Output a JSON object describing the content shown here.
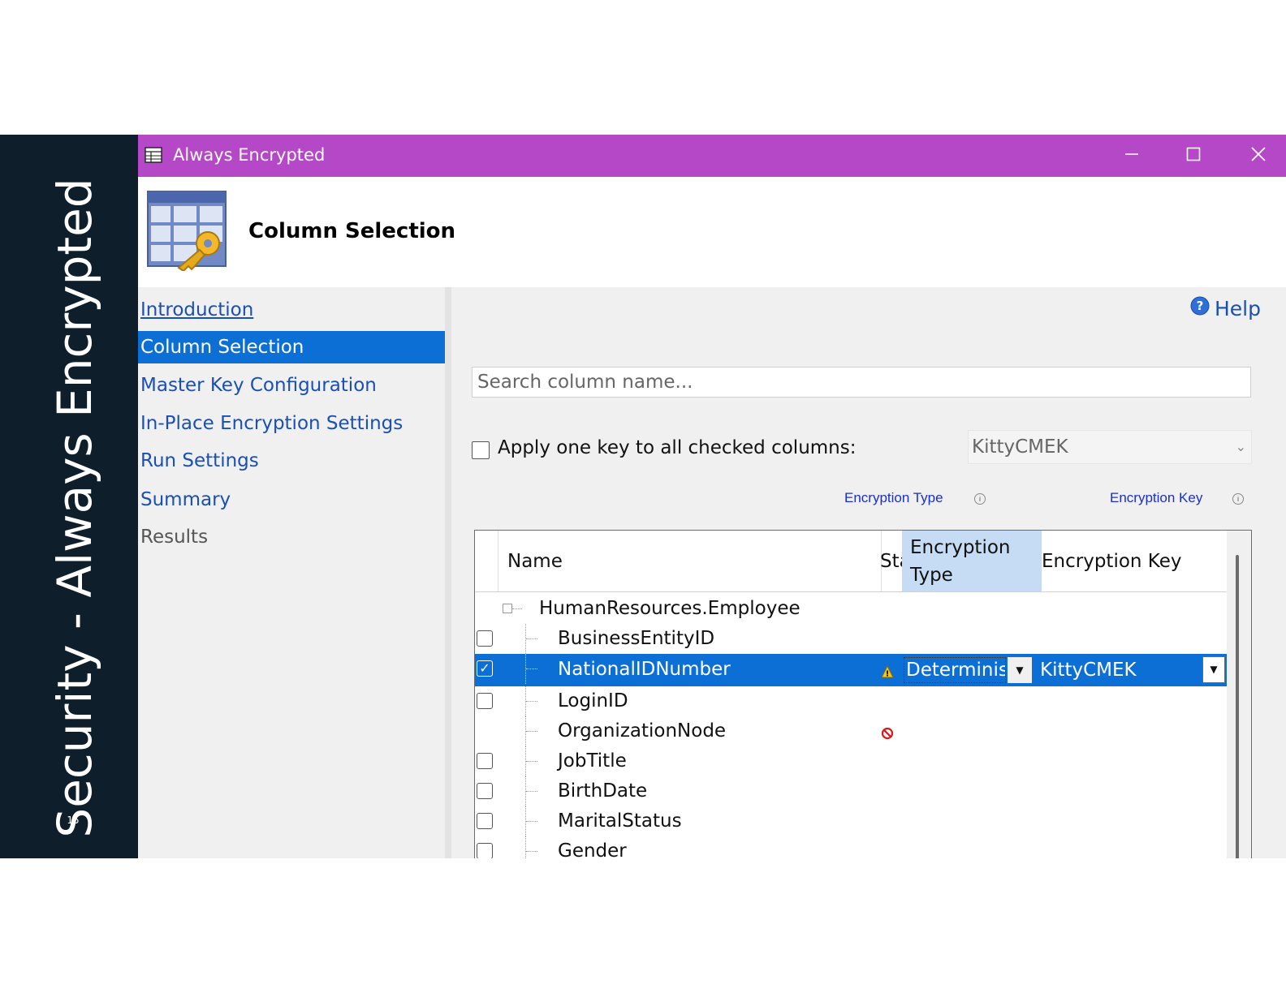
{
  "slide": {
    "title": "Security - Always Encrypted",
    "page_number": "15"
  },
  "window": {
    "title": "Always Encrypted",
    "icons": {
      "app": "wizard-table-icon",
      "minimize": "minimize-icon",
      "maximize": "maximize-icon",
      "close": "close-icon"
    }
  },
  "header": {
    "title": "Column Selection",
    "icon": "table-key-icon"
  },
  "nav": {
    "items": [
      {
        "label": "Introduction",
        "state": "link"
      },
      {
        "label": "Column Selection",
        "state": "active"
      },
      {
        "label": "Master Key Configuration",
        "state": "normal"
      },
      {
        "label": "In-Place Encryption Settings",
        "state": "normal"
      },
      {
        "label": "Run Settings",
        "state": "normal"
      },
      {
        "label": "Summary",
        "state": "normal"
      },
      {
        "label": "Results",
        "state": "disabled"
      }
    ]
  },
  "main": {
    "help_label": "Help",
    "search_placeholder": "Search column name...",
    "apply_label": "Apply one key to all checked columns:",
    "apply_key_value": "KittyCMEK",
    "encryption_type_link": "Encryption Type",
    "encryption_key_link": "Encryption Key"
  },
  "grid": {
    "columns": {
      "name": "Name",
      "state": "Sta",
      "encryption_type": "Encryption Type",
      "encryption_key": "Encryption Key"
    },
    "table_name": "HumanResources.Employee",
    "rows": [
      {
        "name": "BusinessEntityID",
        "checked": false,
        "status": "",
        "type": "",
        "key": ""
      },
      {
        "name": "NationalIDNumber",
        "checked": true,
        "status": "warning-icon",
        "type": "Determinist",
        "key": "KittyCMEK"
      },
      {
        "name": "LoginID",
        "checked": false,
        "status": "",
        "type": "",
        "key": ""
      },
      {
        "name": "OrganizationNode",
        "checked": null,
        "status": "blocked-icon",
        "type": "",
        "key": ""
      },
      {
        "name": "JobTitle",
        "checked": false,
        "status": "",
        "type": "",
        "key": ""
      },
      {
        "name": "BirthDate",
        "checked": false,
        "status": "",
        "type": "",
        "key": ""
      },
      {
        "name": "MaritalStatus",
        "checked": false,
        "status": "",
        "type": "",
        "key": ""
      },
      {
        "name": "Gender",
        "checked": false,
        "status": "",
        "type": "",
        "key": ""
      }
    ]
  },
  "colors": {
    "titlebar": "#b548c6",
    "selection": "#0c6fd6",
    "band": "#0e1e2a",
    "link": "#1a4fb5"
  }
}
